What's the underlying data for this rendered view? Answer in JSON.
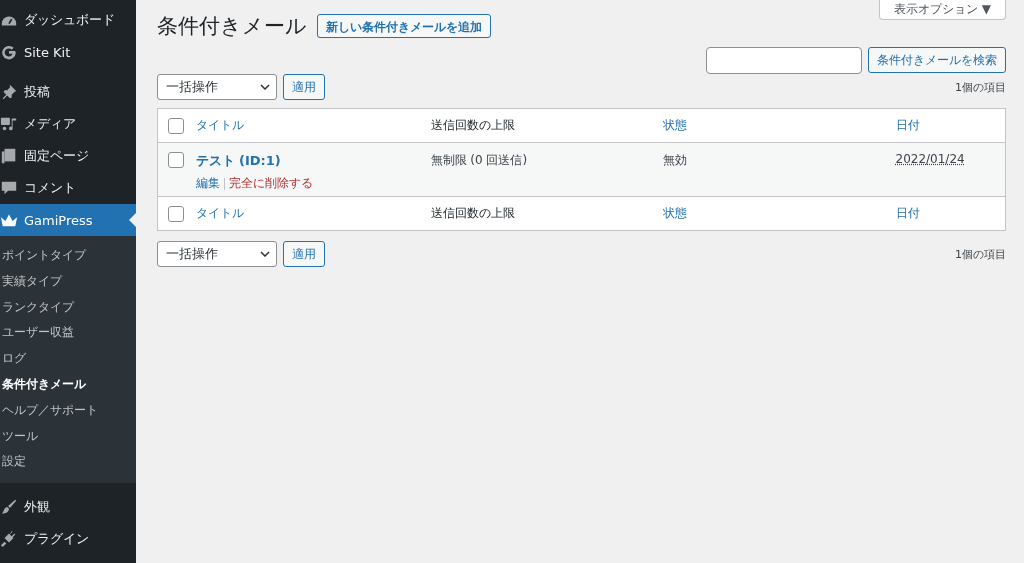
{
  "sidebar": {
    "groups": [
      [
        {
          "label": "ダッシュボード",
          "selected": false
        },
        {
          "label": "Site Kit",
          "selected": false
        }
      ],
      [
        {
          "label": "投稿",
          "selected": false
        },
        {
          "label": "メディア",
          "selected": false
        },
        {
          "label": "固定ページ",
          "selected": false
        },
        {
          "label": "コメント",
          "selected": false
        },
        {
          "label": "GamiPress",
          "selected": true,
          "children": [
            {
              "label": "ポイントタイプ",
              "selected": false
            },
            {
              "label": "実績タイプ",
              "selected": false
            },
            {
              "label": "ランクタイプ",
              "selected": false
            },
            {
              "label": "ユーザー収益",
              "selected": false
            },
            {
              "label": "ログ",
              "selected": false
            },
            {
              "label": "条件付きメール",
              "selected": true
            },
            {
              "label": "ヘルプ／サポート",
              "selected": false
            },
            {
              "label": "ツール",
              "selected": false
            },
            {
              "label": "設定",
              "selected": false
            }
          ]
        }
      ],
      [
        {
          "label": "外観",
          "selected": false
        },
        {
          "label": "プラグイン",
          "selected": false
        }
      ]
    ]
  },
  "screen_options": "表示オプション ▼",
  "page_title": "条件付きメール",
  "add_new_button": "新しい条件付きメールを追加",
  "search": {
    "button": "条件付きメールを検索"
  },
  "bulk_top": {
    "select": "一括操作",
    "apply": "適用",
    "count": "1個の項目"
  },
  "table": {
    "header_checked": false,
    "footer_checked": false,
    "columns": [
      {
        "label": "タイトル",
        "sortable": true
      },
      {
        "label": "送信回数の上限",
        "sortable": false
      },
      {
        "label": "状態",
        "sortable": true
      },
      {
        "label": "日付",
        "sortable": true
      }
    ],
    "rows": [
      {
        "checked": false,
        "title": "テスト (ID:1)",
        "actions": [
          {
            "label": "編集",
            "kind": "normal"
          },
          {
            "label": "完全に削除する",
            "kind": "danger"
          }
        ],
        "limit": "無制限 (0 回送信)",
        "status": "無効",
        "date": "2022/01/24"
      }
    ],
    "footer_columns": [
      {
        "label": "タイトル",
        "sortable": true
      },
      {
        "label": "送信回数の上限",
        "sortable": false
      },
      {
        "label": "状態",
        "sortable": true
      },
      {
        "label": "日付",
        "sortable": true
      }
    ]
  },
  "bulk_bottom": {
    "select": "一括操作",
    "apply": "適用",
    "count": "1個の項目"
  }
}
